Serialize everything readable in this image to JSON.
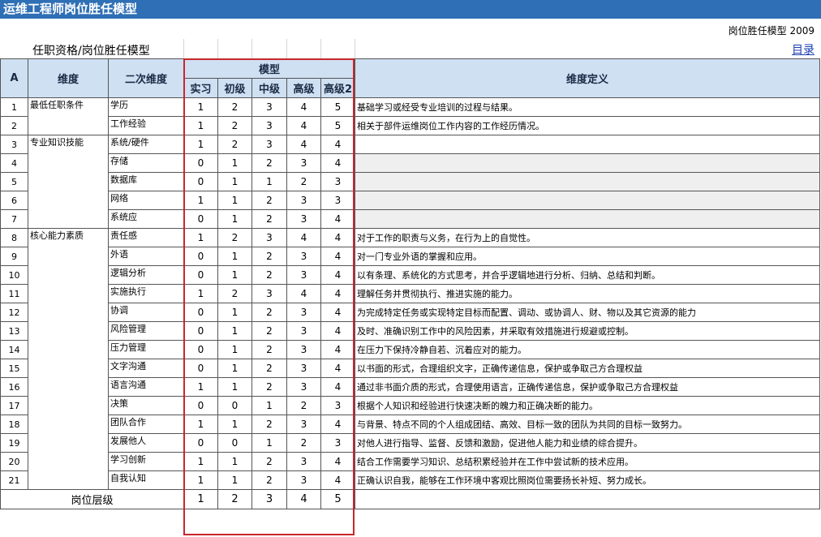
{
  "sheet": {
    "title": "运维工程师岗位胜任模型",
    "brand": "岗位胜任模型 2009",
    "subtitle": "任职资格/岗位胜任模型",
    "toc_link": "目录"
  },
  "table": {
    "headers": {
      "corner": "A",
      "dimension": "维度",
      "sub_dimension": "二次维度",
      "model": "模型",
      "levels": [
        "实习",
        "初级",
        "中级",
        "高级",
        "高级2"
      ],
      "definition": "维度定义"
    },
    "groups": [
      {
        "name": "最低任职条件",
        "start": 0,
        "span": 2
      },
      {
        "name": "专业知识技能",
        "start": 2,
        "span": 5
      },
      {
        "name": "核心能力素质",
        "start": 7,
        "span": 14
      }
    ],
    "rows": [
      {
        "no": "1",
        "sub": "学历",
        "values": [
          "1",
          "2",
          "3",
          "4",
          "5"
        ],
        "def": "基础学习或经受专业培训的过程与结果。"
      },
      {
        "no": "2",
        "sub": "工作经验",
        "values": [
          "1",
          "2",
          "3",
          "4",
          "5"
        ],
        "def": "相关于部件运维岗位工作内容的工作经历情况。"
      },
      {
        "no": "3",
        "sub": "系统/硬件",
        "values": [
          "1",
          "2",
          "3",
          "4",
          "4"
        ],
        "def": ""
      },
      {
        "no": "4",
        "sub": "存储",
        "values": [
          "0",
          "1",
          "2",
          "3",
          "4"
        ],
        "def": ""
      },
      {
        "no": "5",
        "sub": "数据库",
        "values": [
          "0",
          "1",
          "1",
          "2",
          "3"
        ],
        "def": ""
      },
      {
        "no": "6",
        "sub": "网络",
        "values": [
          "1",
          "1",
          "2",
          "3",
          "3"
        ],
        "def": ""
      },
      {
        "no": "7",
        "sub": "系统应",
        "values": [
          "0",
          "1",
          "2",
          "3",
          "4"
        ],
        "def": ""
      },
      {
        "no": "8",
        "sub": "责任感",
        "values": [
          "1",
          "2",
          "3",
          "4",
          "4"
        ],
        "def": "对于工作的职责与义务，在行为上的自觉性。"
      },
      {
        "no": "9",
        "sub": "外语",
        "values": [
          "0",
          "1",
          "2",
          "3",
          "4"
        ],
        "def": "对一门专业外语的掌握和应用。"
      },
      {
        "no": "10",
        "sub": "逻辑分析",
        "values": [
          "0",
          "1",
          "2",
          "3",
          "4"
        ],
        "def": "以有条理、系统化的方式思考，并合乎逻辑地进行分析、归纳、总结和判断。"
      },
      {
        "no": "11",
        "sub": "实施执行",
        "values": [
          "1",
          "2",
          "3",
          "4",
          "4"
        ],
        "def": "理解任务并贯彻执行、推进实施的能力。"
      },
      {
        "no": "12",
        "sub": "协调",
        "values": [
          "0",
          "1",
          "2",
          "3",
          "4"
        ],
        "def": "为完成特定任务或实现特定目标而配置、调动、或协调人、财、物以及其它资源的能力"
      },
      {
        "no": "13",
        "sub": "风险管理",
        "values": [
          "0",
          "1",
          "2",
          "3",
          "4"
        ],
        "def": "及时、准确识别工作中的风险因素，并采取有效措施进行规避或控制。"
      },
      {
        "no": "14",
        "sub": "压力管理",
        "values": [
          "0",
          "1",
          "2",
          "3",
          "4"
        ],
        "def": "在压力下保持冷静自若、沉着应对的能力。"
      },
      {
        "no": "15",
        "sub": "文字沟通",
        "values": [
          "0",
          "1",
          "2",
          "3",
          "4"
        ],
        "def": "以书面的形式，合理组织文字，正确传递信息，保护或争取己方合理权益"
      },
      {
        "no": "16",
        "sub": "语言沟通",
        "values": [
          "1",
          "1",
          "2",
          "3",
          "4"
        ],
        "def": "通过非书面介质的形式，合理使用语言，正确传递信息，保护或争取己方合理权益"
      },
      {
        "no": "17",
        "sub": "决策",
        "values": [
          "0",
          "0",
          "1",
          "2",
          "3"
        ],
        "def": "根据个人知识和经验进行快速决断的魄力和正确决断的能力。"
      },
      {
        "no": "18",
        "sub": "团队合作",
        "values": [
          "1",
          "1",
          "2",
          "3",
          "4"
        ],
        "def": "与背景、特点不同的个人组成团结、高效、目标一致的团队为共同的目标一致努力。"
      },
      {
        "no": "19",
        "sub": "发展他人",
        "values": [
          "0",
          "0",
          "1",
          "2",
          "3"
        ],
        "def": "对他人进行指导、监督、反馈和激励，促进他人能力和业绩的综合提升。"
      },
      {
        "no": "20",
        "sub": "学习创新",
        "values": [
          "1",
          "1",
          "2",
          "3",
          "4"
        ],
        "def": "结合工作需要学习知识、总结积累经验并在工作中尝试新的技术应用。"
      },
      {
        "no": "21",
        "sub": "自我认知",
        "values": [
          "1",
          "1",
          "2",
          "3",
          "4"
        ],
        "def": "正确认识自我，能够在工作环境中客观比照岗位需要扬长补短、努力成长。"
      }
    ],
    "footer": {
      "label": "岗位层级",
      "values": [
        "1",
        "2",
        "3",
        "4",
        "5"
      ]
    }
  }
}
